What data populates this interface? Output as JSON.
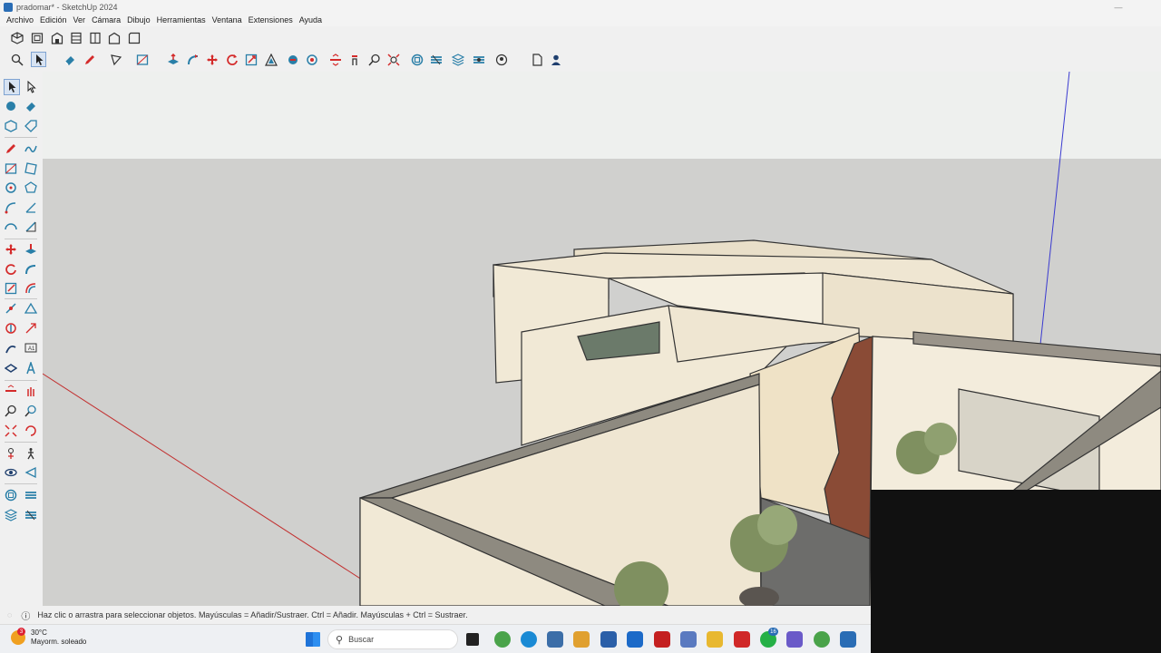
{
  "window": {
    "title": "pradomar* - SketchUp 2024",
    "controls": [
      "—",
      "☐",
      "✕"
    ]
  },
  "menu": [
    "Archivo",
    "Edición",
    "Ver",
    "Cámara",
    "Dibujo",
    "Herramientas",
    "Ventana",
    "Extensiones",
    "Ayuda"
  ],
  "toolbar_views": [
    "iso-view-icon",
    "top-view-icon",
    "front-view-icon",
    "right-view-icon",
    "back-view-icon",
    "left-view-icon",
    "bottom-view-icon"
  ],
  "toolbar_main": [
    "search-icon",
    "select-icon",
    "eraser-icon",
    "pencil-icon",
    "line-icon",
    "rectangle-icon",
    "push-pull-icon",
    "follow-me-icon",
    "move-icon",
    "rotate-icon",
    "scale-icon",
    "offset-icon",
    "paint-icon",
    "component-icon",
    "section-plane-icon",
    "walk-icon",
    "zoom-icon",
    "zoom-extents-icon",
    "warehouse-icon",
    "extension-warehouse-icon",
    "layers-icon",
    "styles-icon",
    "account-icon",
    "new-file-icon",
    "user-icon"
  ],
  "status": {
    "message": "Haz clic o arrastra para seleccionar objetos. Mayúsculas = Añadir/Sustraer. Ctrl = Añadir. Mayúsculas + Ctrl = Sustraer."
  },
  "taskbar": {
    "temperature": "30°C",
    "condition": "Mayorm. soleado",
    "weather_badge": "3",
    "search_placeholder": "Buscar",
    "whatsapp_badge": "16"
  },
  "colors": {
    "accent": "#2a6db5",
    "tool_red": "#d42b2b",
    "tool_teal": "#2a7fa8",
    "sky": "#eef0ee",
    "ground": "#d0d0ce",
    "wall": "#efe6d2"
  }
}
